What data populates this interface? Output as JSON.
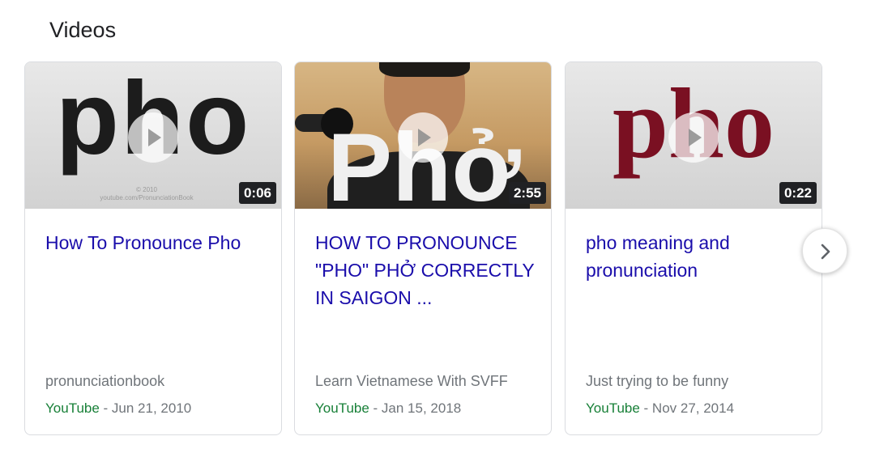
{
  "section": {
    "title": "Videos"
  },
  "cards": [
    {
      "thumb_text": "pho",
      "watermark": "© 2010\nyoutube.com/PronunciationBook",
      "duration": "0:06",
      "title": "How To Pronounce Pho",
      "channel": "pronunciationbook",
      "source": "YouTube",
      "date": " - Jun 21, 2010"
    },
    {
      "thumb_text": "Phở",
      "duration": "2:55",
      "title": "HOW TO PRONOUNCE \"PHO\" PHỞ CORRECTLY IN SAIGON ...",
      "channel": "Learn Vietnamese With SVFF",
      "source": "YouTube",
      "date": " - Jan 15, 2018"
    },
    {
      "thumb_text": "pho",
      "duration": "0:22",
      "title": "pho meaning and pronunciation",
      "channel": "Just trying to be funny",
      "source": "YouTube",
      "date": " - Nov 27, 2014"
    }
  ],
  "icons": {
    "play": "play-icon",
    "next": "chevron-right-icon"
  },
  "colors": {
    "link": "#1a0dab",
    "source": "#188038",
    "meta": "#70757a",
    "maroon": "#7a1022"
  }
}
